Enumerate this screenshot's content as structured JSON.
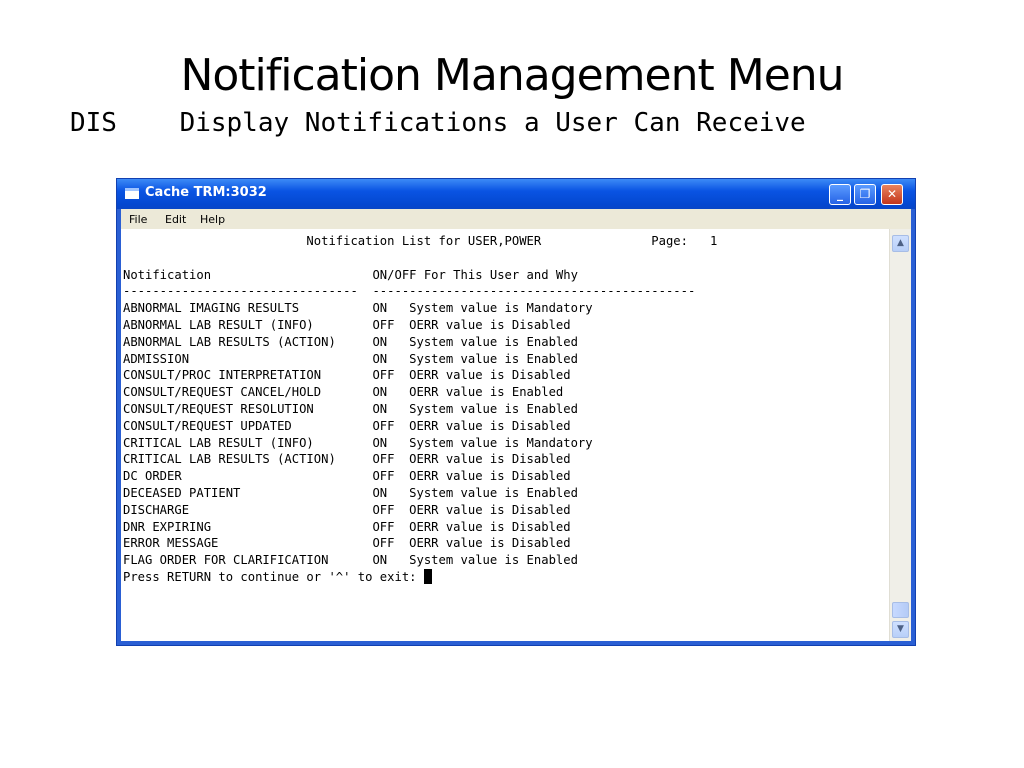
{
  "slide": {
    "title": "Notification Management Menu",
    "subtitle": "DIS    Display Notifications a User Can Receive"
  },
  "window": {
    "title": "Cache TRM:3032",
    "icon": "terminal-window-icon",
    "controls": {
      "minimize": "_",
      "maximize": "❐",
      "close": "✕"
    },
    "titlebar_color": "#0a54e3",
    "close_color": "#c3361c"
  },
  "menu": {
    "file": "File",
    "edit": "Edit",
    "help": "Help"
  },
  "terminal": {
    "header": "                         Notification List for USER,POWER               Page:   1",
    "column_headers": "Notification                      ON/OFF For This User and Why",
    "underline": "--------------------------------  --------------------------------------------",
    "rows": [
      "ABNORMAL IMAGING RESULTS          ON   System value is Mandatory",
      "ABNORMAL LAB RESULT (INFO)        OFF  OERR value is Disabled",
      "ABNORMAL LAB RESULTS (ACTION)     ON   System value is Enabled",
      "ADMISSION                         ON   System value is Enabled",
      "CONSULT/PROC INTERPRETATION       OFF  OERR value is Disabled",
      "CONSULT/REQUEST CANCEL/HOLD       ON   OERR value is Enabled",
      "CONSULT/REQUEST RESOLUTION        ON   System value is Enabled",
      "CONSULT/REQUEST UPDATED           OFF  OERR value is Disabled",
      "CRITICAL LAB RESULT (INFO)        ON   System value is Mandatory",
      "CRITICAL LAB RESULTS (ACTION)     OFF  OERR value is Disabled",
      "DC ORDER                          OFF  OERR value is Disabled",
      "DECEASED PATIENT                  ON   System value is Enabled",
      "DISCHARGE                         OFF  OERR value is Disabled",
      "DNR EXPIRING                      OFF  OERR value is Disabled",
      "ERROR MESSAGE                     OFF  OERR value is Disabled",
      "FLAG ORDER FOR CLARIFICATION      ON   System value is Enabled"
    ],
    "prompt": "Press RETURN to continue or '^' to exit: "
  },
  "scrollbar": {
    "up": "▲",
    "down": "▼"
  }
}
